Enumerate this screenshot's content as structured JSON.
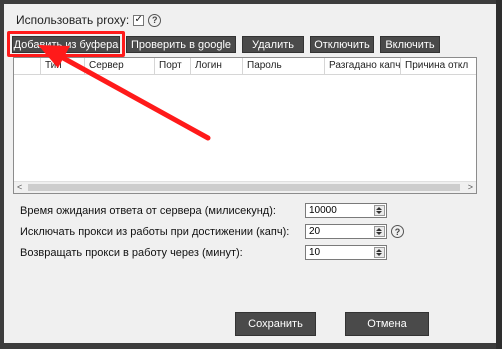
{
  "proxy": {
    "label": "Использовать proxy:",
    "checked": true,
    "check_mark": "✓",
    "help_icon": "?"
  },
  "toolbar": {
    "add_from_buffer": "Добавить из буфера",
    "check_google": "Проверить в google",
    "delete": "Удалить",
    "disable": "Отключить",
    "enable": "Включить"
  },
  "table": {
    "columns": [
      "Тип",
      "Сервер",
      "Порт",
      "Логин",
      "Пароль",
      "Разгадано капч",
      "Причина откл"
    ],
    "rows": [],
    "scroll_left": "<",
    "scroll_right": ">"
  },
  "settings": {
    "timeout_label": "Время ожидания ответа от сервера (милисекунд):",
    "timeout_value": "10000",
    "exclude_label": "Исключать прокси из работы при достижении (капч):",
    "exclude_value": "20",
    "return_label": "Возвращать прокси в работу через (минут):",
    "return_value": "10",
    "help_icon": "?"
  },
  "buttons": {
    "save": "Сохранить",
    "cancel": "Отмена"
  },
  "colors": {
    "highlight": "#ff1a1a",
    "arrow": "#ff1a1a",
    "button_bg": "#4a4a4a"
  }
}
